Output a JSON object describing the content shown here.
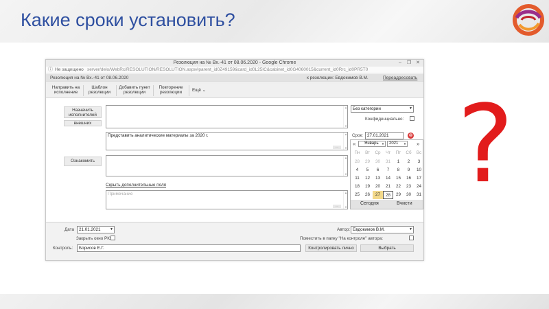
{
  "slide": {
    "title": "Какие сроки установить?",
    "question_mark": "?",
    "colors": {
      "title": "#2e4fa0",
      "question": "#e21c1c",
      "today_highlight": "#f3d98a",
      "clear_icon": "#d83a3a"
    }
  },
  "window": {
    "title": "Резолюция на № Вх.-41 от 08.06.2020 - Google Chrome",
    "controls": [
      "–",
      "❐",
      "✕"
    ],
    "security_warning": "Не защищено",
    "url": "server/delo/WebRc/RESOLUTION/RESOLUTION.aspx#parent_id0Z49159&card_id0L25IC&cabinet_id0G4060015&current_id0Rrc_id0PR5T0"
  },
  "app": {
    "document": "Резолюция на № Вх.-41 от 08.06.2020",
    "resolution_to": "к резолюции: Евдокимов В.М.",
    "redirect_link": "Переадресовать"
  },
  "toolbar": {
    "items": [
      [
        "Направить на",
        "исполнение"
      ],
      [
        "Шаблон",
        "резолюции"
      ],
      [
        "Добавить пункт",
        "резолюции"
      ],
      [
        "Повторение",
        "резолюции"
      ]
    ],
    "more": "Ещё"
  },
  "form": {
    "assign_button": [
      "Назначить",
      "исполнителей"
    ],
    "external_button": "внешних",
    "category": "Без категории",
    "confidential_label": "Конфиденциально:",
    "deadline_label": "Срок:",
    "deadline_value": "27.01.2021",
    "resolution_text": "Представить аналитические материалы за 2020 г.",
    "acquaint_button": "Ознакомить",
    "hide_fields_link": "Скрыть дополнительные поля",
    "note_placeholder": "Примечание"
  },
  "calendar": {
    "month": "Январь",
    "year": "2021",
    "weekdays": [
      "Пн",
      "Вт",
      "Ср",
      "Чт",
      "Пт",
      "Сб",
      "Вс"
    ],
    "weeks": [
      [
        "28",
        "29",
        "30",
        "31",
        "1",
        "2",
        "3"
      ],
      [
        "4",
        "5",
        "6",
        "7",
        "8",
        "9",
        "10"
      ],
      [
        "11",
        "12",
        "13",
        "14",
        "15",
        "16",
        "17"
      ],
      [
        "18",
        "19",
        "20",
        "21",
        "22",
        "23",
        "24"
      ],
      [
        "25",
        "26",
        "27",
        "28",
        "29",
        "30",
        "31"
      ]
    ],
    "today_label": "Сегодня",
    "clear_label": "Вчисти"
  },
  "footer": {
    "date_label": "Дата",
    "date_value": "21.01.2021",
    "close_rk_label": "Закрыть окно РК:",
    "control_label": "Контроль:",
    "control_value": "Борисов Е.Г.",
    "control_button": "Контролировать лично",
    "select_button": "Выбрать",
    "author_label": "Автор:",
    "author_value": "Евдокимов В.М.",
    "folder_label": "Поместить в папку \"На контроле\" автора:"
  }
}
